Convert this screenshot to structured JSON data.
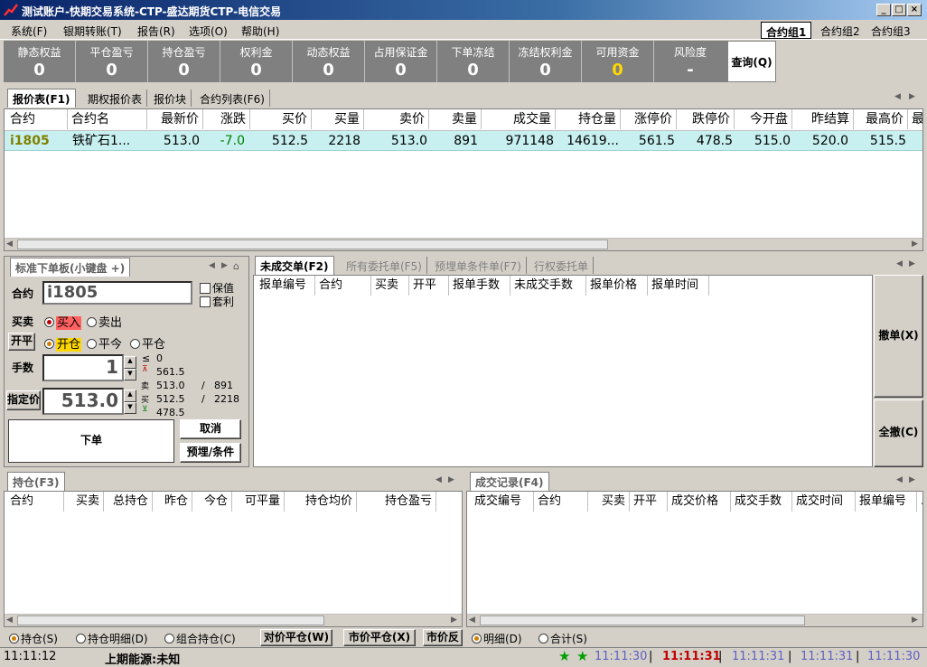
{
  "window": {
    "title": "测试账户-快期交易系统-CTP-盛达期货CTP-电信交易"
  },
  "menu": [
    "系统(F)",
    "银期转账(T)",
    "报告(R)",
    "选项(O)",
    "帮助(H)"
  ],
  "contract_groups": [
    "合约组1",
    "合约组2",
    "合约组3"
  ],
  "summary": [
    {
      "label": "静态权益",
      "value": "0"
    },
    {
      "label": "平仓盈亏",
      "value": "0"
    },
    {
      "label": "持仓盈亏",
      "value": "0"
    },
    {
      "label": "权利金",
      "value": "0"
    },
    {
      "label": "动态权益",
      "value": "0"
    },
    {
      "label": "占用保证金",
      "value": "0"
    },
    {
      "label": "下单冻结",
      "value": "0"
    },
    {
      "label": "冻结权利金",
      "value": "0"
    },
    {
      "label": "可用资金",
      "value": "0"
    },
    {
      "label": "风险度",
      "value": "-"
    }
  ],
  "query_button": "查询(Q)",
  "quote_tabs": [
    "报价表(F1)",
    "期权报价表",
    "报价块",
    "合约列表(F6)"
  ],
  "quote_columns": [
    "合约",
    "合约名",
    "最新价",
    "涨跌",
    "买价",
    "买量",
    "卖价",
    "卖量",
    "成交量",
    "持仓量",
    "涨停价",
    "跌停价",
    "今开盘",
    "昨结算",
    "最高价",
    "最"
  ],
  "quote_rows": [
    {
      "code": "i1805",
      "name": "铁矿石1...",
      "last": "513.0",
      "change": "-7.0",
      "bid": "512.5",
      "bid_vol": "2218",
      "ask": "513.0",
      "ask_vol": "891",
      "volume": "971148",
      "oi": "14619...",
      "upper": "561.5",
      "lower": "478.5",
      "open": "515.0",
      "presettle": "520.0",
      "high": "515.5"
    }
  ],
  "order_panel": {
    "tab": "标准下单板(小键盘 +)",
    "contract_label": "合约",
    "contract_value": "i1805",
    "hedge_label": "保值",
    "arb_label": "套利",
    "side_label": "买卖",
    "buy": "买入",
    "sell": "卖出",
    "offset_label": "开平",
    "open": "开仓",
    "close_today": "平今",
    "close": "平仓",
    "qty_label": "手数",
    "qty_value": "1",
    "price_label": "指定价",
    "price_value": "513.0",
    "le_sym": "≤",
    "le_val": "0",
    "upper": "561.5",
    "sell_px": "513.0",
    "sell_vol": "891",
    "buy_px": "512.5",
    "buy_vol": "2218",
    "lower": "478.5",
    "sell_ch": "卖",
    "buy_ch": "买",
    "slash": "/",
    "submit": "下单",
    "cancel": "取消",
    "preset": "预埋/条件"
  },
  "pending_tabs": [
    "未成交单(F2)",
    "所有委托单(F5)",
    "预埋单条件单(F7)",
    "行权委托单"
  ],
  "pending_columns": [
    "报单编号",
    "合约",
    "买卖",
    "开平",
    "报单手数",
    "未成交手数",
    "报单价格",
    "报单时间"
  ],
  "pending_buttons": {
    "cancel": "撤单(X)",
    "cancel_all": "全撤(C)"
  },
  "positions_tab": "持仓(F3)",
  "positions_columns": [
    "合约",
    "买卖",
    "总持仓",
    "昨仓",
    "今仓",
    "可平量",
    "持仓均价",
    "持仓盈亏"
  ],
  "positions_footer": {
    "opt1": "持仓(S)",
    "opt2": "持仓明细(D)",
    "opt3": "组合持仓(C)",
    "btn1": "对价平仓(W)",
    "btn2": "市价平仓(X)",
    "btn3": "市价反"
  },
  "trades_tab": "成交记录(F4)",
  "trades_columns": [
    "成交编号",
    "合约",
    "买卖",
    "开平",
    "成交价格",
    "成交手数",
    "成交时间",
    "报单编号",
    "."
  ],
  "trades_footer": {
    "opt1": "明细(D)",
    "opt2": "合计(S)"
  },
  "status": {
    "time": "11:11:12",
    "energy": "上期能源:未知",
    "t1": "11:11:30",
    "t2": "11:11:31",
    "t3": "11:11:31",
    "t4": "11:11:31",
    "t5": "11:11:30",
    "sep": "|"
  },
  "colors": {
    "green": "#008000",
    "red": "#c00000",
    "yellow": "#ffd700"
  }
}
